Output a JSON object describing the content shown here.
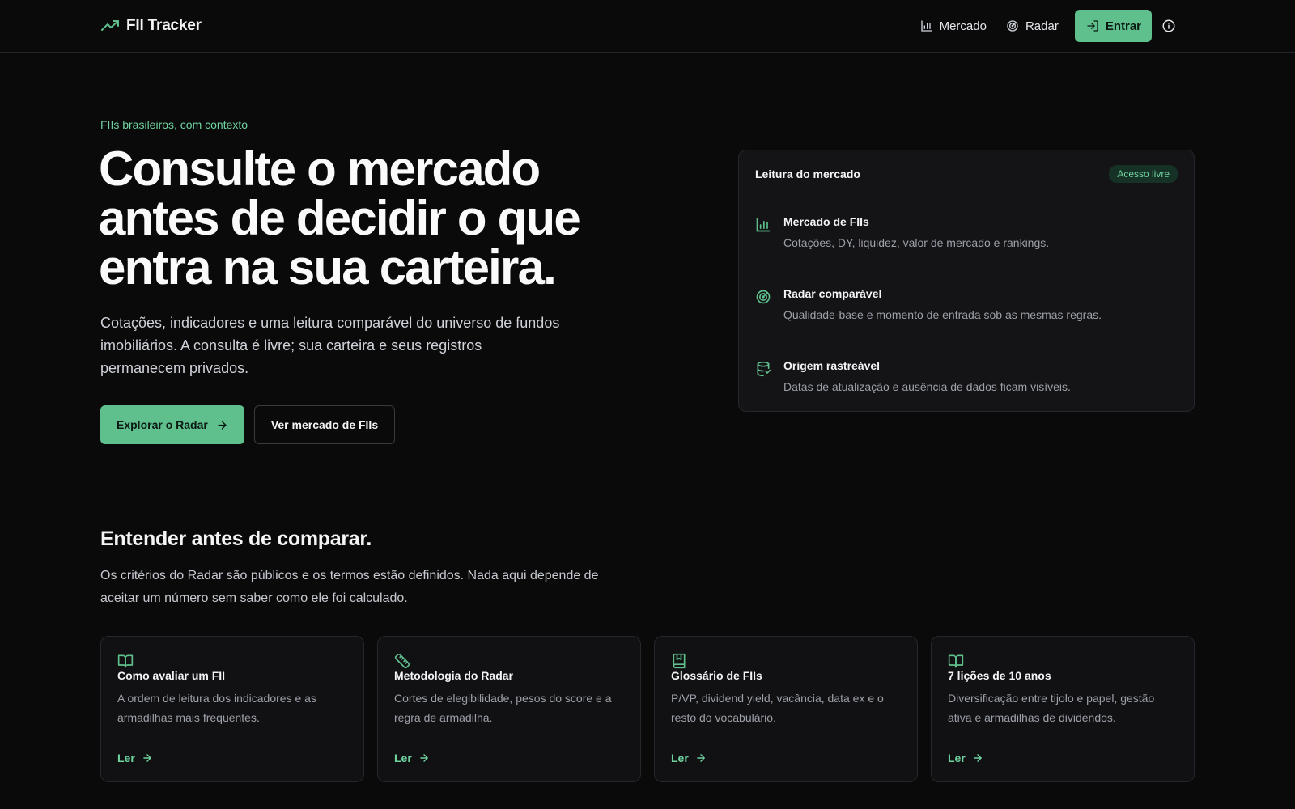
{
  "header": {
    "brand": "FII Tracker",
    "nav": [
      {
        "label": "Mercado",
        "icon": "bar-chart-icon"
      },
      {
        "label": "Radar",
        "icon": "radar-icon"
      }
    ],
    "enter_label": "Entrar",
    "info_icon": "info-icon"
  },
  "hero": {
    "eyebrow": "FIIs brasileiros, com contexto",
    "title": "Consulte o mercado antes de decidir o que entra na sua carteira.",
    "subtitle": "Cotações, indicadores e uma leitura comparável do universo de fundos imobiliários. A consulta é livre; sua carteira e seus registros permanecem privados.",
    "primary_cta": "Explorar o Radar",
    "secondary_cta": "Ver mercado de FIIs"
  },
  "panel": {
    "title": "Leitura do mercado",
    "badge": "Acesso livre",
    "items": [
      {
        "title": "Mercado de FIIs",
        "desc": "Cotações, DY, liquidez, valor de mercado e rankings.",
        "icon": "bar-chart-icon"
      },
      {
        "title": "Radar comparável",
        "desc": "Qualidade-base e momento de entrada sob as mesmas regras.",
        "icon": "radar-icon"
      },
      {
        "title": "Origem rastreável",
        "desc": "Datas de atualização e ausência de dados ficam visíveis.",
        "icon": "database-icon"
      }
    ]
  },
  "section": {
    "title": "Entender antes de comparar.",
    "subtitle": "Os critérios do Radar são públicos e os termos estão definidos. Nada aqui depende de aceitar um número sem saber como ele foi calculado.",
    "cards": [
      {
        "title": "Como avaliar um FII",
        "desc": "A ordem de leitura dos indicadores e as armadilhas mais frequentes.",
        "link": "Ler",
        "icon": "book-open-icon"
      },
      {
        "title": "Metodologia do Radar",
        "desc": "Cortes de elegibilidade, pesos do score e a regra de armadilha.",
        "link": "Ler",
        "icon": "ruler-icon"
      },
      {
        "title": "Glossário de FIIs",
        "desc": "P/VP, dividend yield, vacância, data ex e o resto do vocabulário.",
        "link": "Ler",
        "icon": "bookmark-book-icon"
      },
      {
        "title": "7 lições de 10 anos",
        "desc": "Diversificação entre tijolo e papel, gestão ativa e armadilhas de dividendos.",
        "link": "Ler",
        "icon": "book-open-icon"
      }
    ]
  },
  "colors": {
    "background": "#0a0a0b",
    "accent": "#5fc08d",
    "accent_text": "#6fd39f",
    "card": "#111113",
    "border": "#26272c"
  }
}
